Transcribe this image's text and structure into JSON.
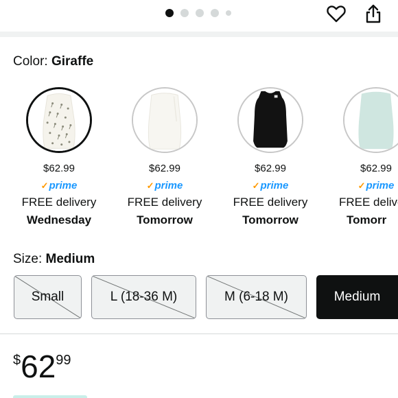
{
  "header": {
    "carousel_dots": 5,
    "active_dot": 0,
    "wishlist_icon": "heart-icon",
    "share_icon": "share-icon"
  },
  "color": {
    "label": "Color:",
    "selected": "Giraffe",
    "options": [
      {
        "name": "Giraffe",
        "price": "$62.99",
        "prime": "prime",
        "delivery": "FREE delivery",
        "day": "Wednesday",
        "swatch_color": "#f5f3ec",
        "selected": true
      },
      {
        "name": "Cream",
        "price": "$62.99",
        "prime": "prime",
        "delivery": "FREE delivery",
        "day": "Tomorrow",
        "swatch_color": "#f7f6f1",
        "selected": false
      },
      {
        "name": "Black",
        "price": "$62.99",
        "prime": "prime",
        "delivery": "FREE delivery",
        "day": "Tomorrow",
        "swatch_color": "#111111",
        "selected": false
      },
      {
        "name": "Mint",
        "price": "$62.99",
        "prime": "prime",
        "delivery": "FREE delive",
        "day": "Tomorr",
        "swatch_color": "#cfe6e0",
        "selected": false
      }
    ]
  },
  "size": {
    "label": "Size:",
    "selected": "Medium",
    "options": [
      {
        "label": "Small",
        "available": false
      },
      {
        "label": "L (18-36 M)",
        "available": false
      },
      {
        "label": "M (6-18 M)",
        "available": false
      },
      {
        "label": "Medium",
        "available": true,
        "selected": true
      }
    ]
  },
  "price": {
    "symbol": "$",
    "whole": "62",
    "fraction": "99"
  },
  "colors": {
    "prime_blue": "#1a98ff",
    "prime_check": "#ff9900",
    "selected_bg": "#0f1111"
  }
}
